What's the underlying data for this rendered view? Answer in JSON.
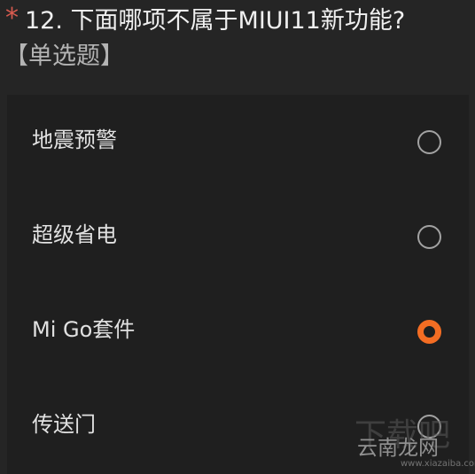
{
  "question": {
    "required_mark": "*",
    "title": "12. 下面哪项不属于MIUI11新功能?",
    "type_label": "【单选题】"
  },
  "options": [
    {
      "label": "地震预警",
      "selected": false
    },
    {
      "label": "超级省电",
      "selected": false
    },
    {
      "label": "Mi Go套件",
      "selected": true
    },
    {
      "label": "传送门",
      "selected": false
    }
  ],
  "watermark": {
    "big_text": "下载吧",
    "site_text": "云南龙网",
    "url": "www.xiazaiba.com"
  },
  "colors": {
    "background": "#252525",
    "options_panel": "#1f1f1f",
    "text_primary": "#f0f0f0",
    "text_secondary": "#b4b4b4",
    "required_mark": "#d85b4f",
    "radio_selected": "#f46d23",
    "radio_unselected": "#a2a2a2"
  }
}
